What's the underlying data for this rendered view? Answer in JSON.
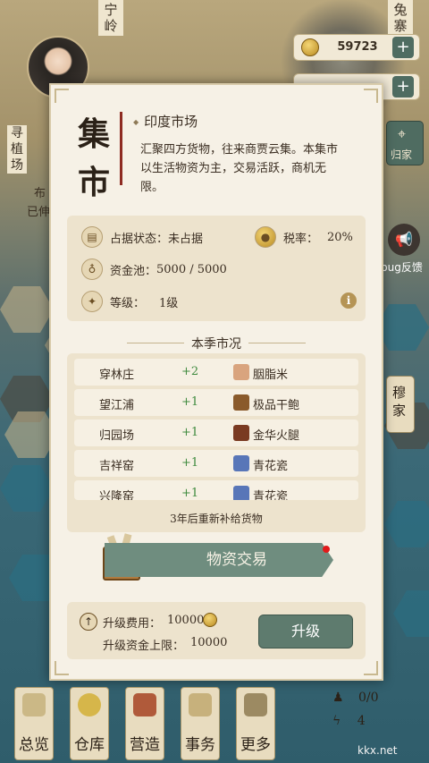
{
  "map": {
    "labels": [
      "宁岭",
      "兔寨"
    ],
    "left_notice": "寻植场",
    "left_notice_2": "布",
    "left_notice_3": "已伸",
    "colors": {
      "sea": "#2b6e82",
      "land": "#c9b48a"
    }
  },
  "top_bar": {
    "coins": "59723",
    "plus_label": "+"
  },
  "right_side": {
    "home_label": "归家",
    "feedback_label": "bug反馈",
    "mu_label": "穆家"
  },
  "dialog": {
    "title": "集市",
    "market_name": "印度市场",
    "description": "汇聚四方货物，往来商贾云集。本集市以生活物资为主，交易活跃，商机无限。",
    "stats": {
      "occupy_label": "占据状态：未占据",
      "tax_label": "税率：",
      "tax_value": "20%",
      "fund_label": "资金池：",
      "fund_value": "5000 / 5000",
      "level_label": "等级：",
      "level_value": "1级",
      "info_icon_text": "i"
    },
    "season_title": "本季市况",
    "market_rows": [
      {
        "town": "穿林庄",
        "delta": "+2",
        "good": "胭脂米",
        "icon": "rice-bag-icon",
        "icon_color": "#d9a47e"
      },
      {
        "town": "望江浦",
        "delta": "+1",
        "good": "极品干鲍",
        "icon": "abalone-icon",
        "icon_color": "#8a5a2b"
      },
      {
        "town": "归园场",
        "delta": "+1",
        "good": "金华火腿",
        "icon": "ham-icon",
        "icon_color": "#7a3a22"
      },
      {
        "town": "吉祥窑",
        "delta": "+1",
        "good": "青花瓷",
        "icon": "porcelain-icon",
        "icon_color": "#5876b8"
      },
      {
        "town": "兴隆窑",
        "delta": "+1",
        "good": "青花瓷",
        "icon": "porcelain-icon",
        "icon_color": "#5876b8"
      }
    ],
    "restock_text": "3年后重新补给货物",
    "trade_button": "物资交易",
    "upgrade": {
      "cost_label": "升级费用：",
      "cost_value": "10000",
      "fund_cap_label": "升级资金上限：",
      "fund_cap_value": "10000",
      "button": "升级"
    }
  },
  "bottom_nav": [
    {
      "label": "总览",
      "icon": "brush-icon"
    },
    {
      "label": "仓库",
      "icon": "sack-icon"
    },
    {
      "label": "营造",
      "icon": "building-icon"
    },
    {
      "label": "事务",
      "icon": "scroll-icon"
    },
    {
      "label": "更多",
      "icon": "box-icon"
    }
  ],
  "bottom_right": {
    "worker_count": "0/0",
    "energy_count": "4"
  },
  "watermark": "kkx.net"
}
